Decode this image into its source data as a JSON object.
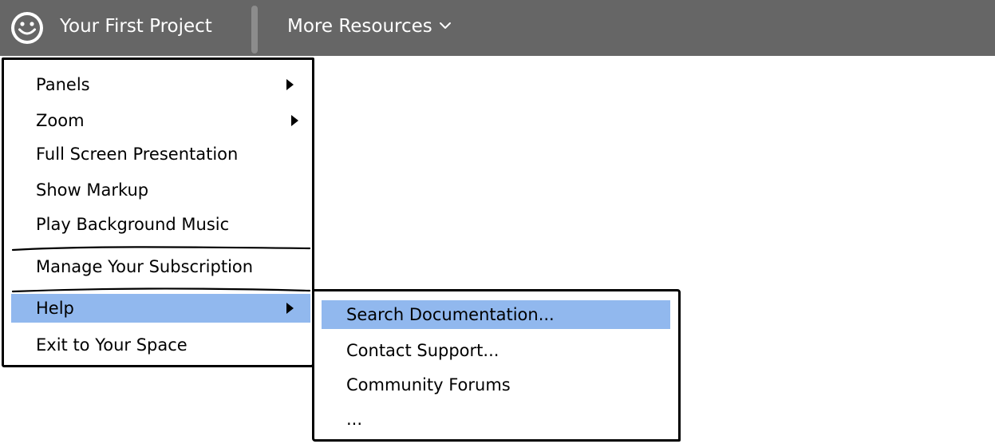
{
  "topbar": {
    "logo_icon": "smiley-face-icon",
    "project_title": "Your First Project",
    "resources_label": "More Resources",
    "resources_icon": "chevron-down-icon",
    "background_color": "#666666"
  },
  "main_menu": {
    "items": [
      {
        "label": "Panels",
        "has_submenu": true
      },
      {
        "label": "Zoom",
        "has_submenu": true
      },
      {
        "label": "Full Screen Presentation",
        "has_submenu": false
      },
      {
        "label": "Show Markup",
        "has_submenu": false
      },
      {
        "label": "Play Background Music",
        "has_submenu": false
      },
      {
        "label": "Manage Your Subscription",
        "has_submenu": false
      },
      {
        "label": "Help",
        "has_submenu": true,
        "highlighted": true
      },
      {
        "label": "Exit to Your Space",
        "has_submenu": false
      }
    ]
  },
  "help_submenu": {
    "items": [
      {
        "label": "Search Documentation...",
        "highlighted": true
      },
      {
        "label": "Contact Support..."
      },
      {
        "label": "Community Forums"
      },
      {
        "label": "..."
      }
    ]
  },
  "colors": {
    "highlight": "#91b8ee",
    "topbar_text": "#ffffff"
  }
}
